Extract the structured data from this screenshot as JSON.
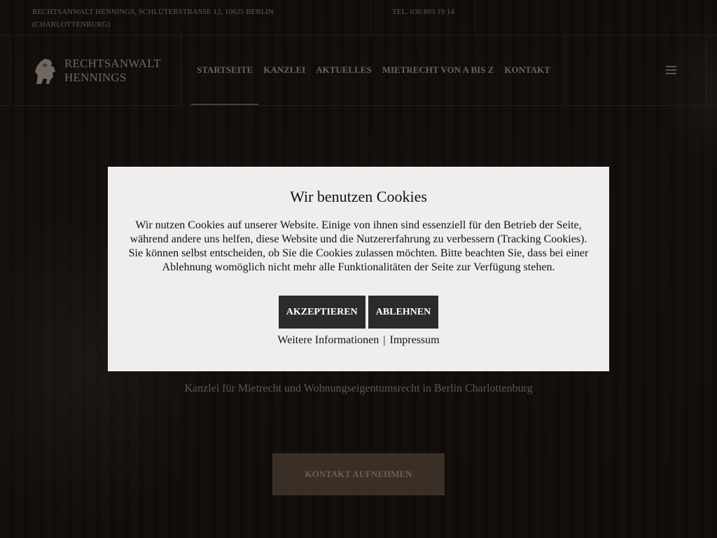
{
  "topbar": {
    "address": "Rechtsanwalt Hennings, Schlüterstraße 12, 10625 Berlin (Charlottenburg)",
    "phone": "Tel. 030 893 19 14"
  },
  "header": {
    "logo_text": "Rechtsanwalt Hennings",
    "logo_icon": "lion-icon",
    "nav": [
      {
        "label": "Startseite",
        "active": true
      },
      {
        "label": "Kanzlei"
      },
      {
        "label": "Aktuelles"
      },
      {
        "label": "Mietrecht von A bis Z"
      },
      {
        "label": "Kontakt"
      }
    ],
    "menu_icon": "hamburger-menu-icon"
  },
  "hero": {
    "subtitle": "Kanzlei für Mietrecht und Wohnungseigentumsrecht in Berlin Charlottenburg",
    "cta_label": "Kontakt aufnehmen"
  },
  "cookie_modal": {
    "title": "Wir benutzen Cookies",
    "text": "Wir nutzen Cookies auf unserer Website. Einige von ihnen sind essenziell für den Betrieb der Seite, während andere uns helfen, diese Website und die Nutzererfahrung zu verbessern (Tracking Cookies). Sie können selbst entscheiden, ob Sie die Cookies zulassen möchten. Bitte beachten Sie, dass bei einer Ablehnung womöglich nicht mehr alle Funktionalitäten der Seite zur Verfügung stehen.",
    "accept_label": "Akzeptieren",
    "decline_label": "Ablehnen",
    "more_info_label": "Weitere Informationen",
    "separator": "|",
    "imprint_label": "Impressum"
  },
  "colors": {
    "modal_bg": "#eeeeee",
    "modal_button_bg": "#2d2b2a",
    "cta_bg": "#3a2f26"
  }
}
